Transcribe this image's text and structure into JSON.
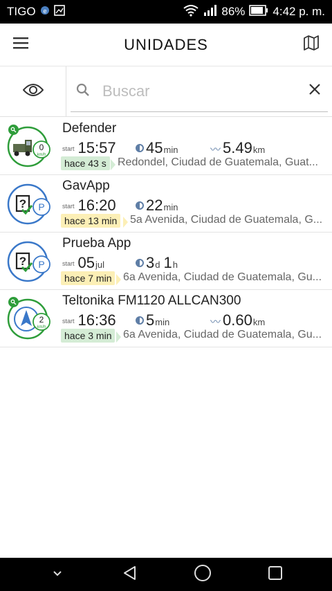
{
  "status_bar": {
    "carrier": "TIGO",
    "battery": "86%",
    "time": "4:42 p. m."
  },
  "app_bar": {
    "title": "UNIDADES",
    "menu_icon": "hamburger-menu-icon",
    "map_icon": "map-icon"
  },
  "search": {
    "placeholder": "Buscar",
    "value": ""
  },
  "units": [
    {
      "name": "Defender",
      "start_label": "start",
      "start": "15:57",
      "start_unit": "",
      "duration": "45",
      "duration_unit": "min",
      "duration2": "",
      "duration2_unit": "",
      "distance": "5.49",
      "distance_unit": "km",
      "ago": "hace 43 s",
      "ago_color": "green",
      "address": "Redondel, Ciudad de Guatemala, Guat...",
      "speed": "0",
      "speed_unit": "km/h",
      "icon": "truck-icon",
      "online": true
    },
    {
      "name": "GavApp",
      "start_label": "start",
      "start": "16:20",
      "start_unit": "",
      "duration": "22",
      "duration_unit": "min",
      "duration2": "",
      "duration2_unit": "",
      "distance": "",
      "distance_unit": "",
      "ago": "hace 13 min",
      "ago_color": "yellow",
      "address": "5a Avenida, Ciudad de Guatemala, G...",
      "badge": "P",
      "icon": "unknown-device-icon",
      "online": false
    },
    {
      "name": "Prueba App",
      "start_label": "start",
      "start": "05",
      "start_unit": "jul",
      "duration": "3",
      "duration_unit": "d",
      "duration2": "1",
      "duration2_unit": "h",
      "distance": "",
      "distance_unit": "",
      "ago": "hace 7 min",
      "ago_color": "yellow",
      "address": "6a Avenida, Ciudad de Guatemala, Gu...",
      "badge": "P",
      "icon": "unknown-device-icon",
      "online": false
    },
    {
      "name": "Teltonika FM1120 ALLCAN300",
      "start_label": "start",
      "start": "16:36",
      "start_unit": "",
      "duration": "5",
      "duration_unit": "min",
      "duration2": "",
      "duration2_unit": "",
      "distance": "0.60",
      "distance_unit": "km",
      "ago": "hace 3 min",
      "ago_color": "green",
      "address": "6a Avenida, Ciudad de Guatemala, Gu...",
      "speed": "2",
      "speed_unit": "km/h",
      "icon": "navigation-arrow-icon",
      "online": true
    }
  ],
  "colors": {
    "ring_green": "#2e9d3a",
    "ring_blue": "#3a78c9",
    "ago_green": "#d4ecd5",
    "ago_yellow": "#fcefb6"
  }
}
